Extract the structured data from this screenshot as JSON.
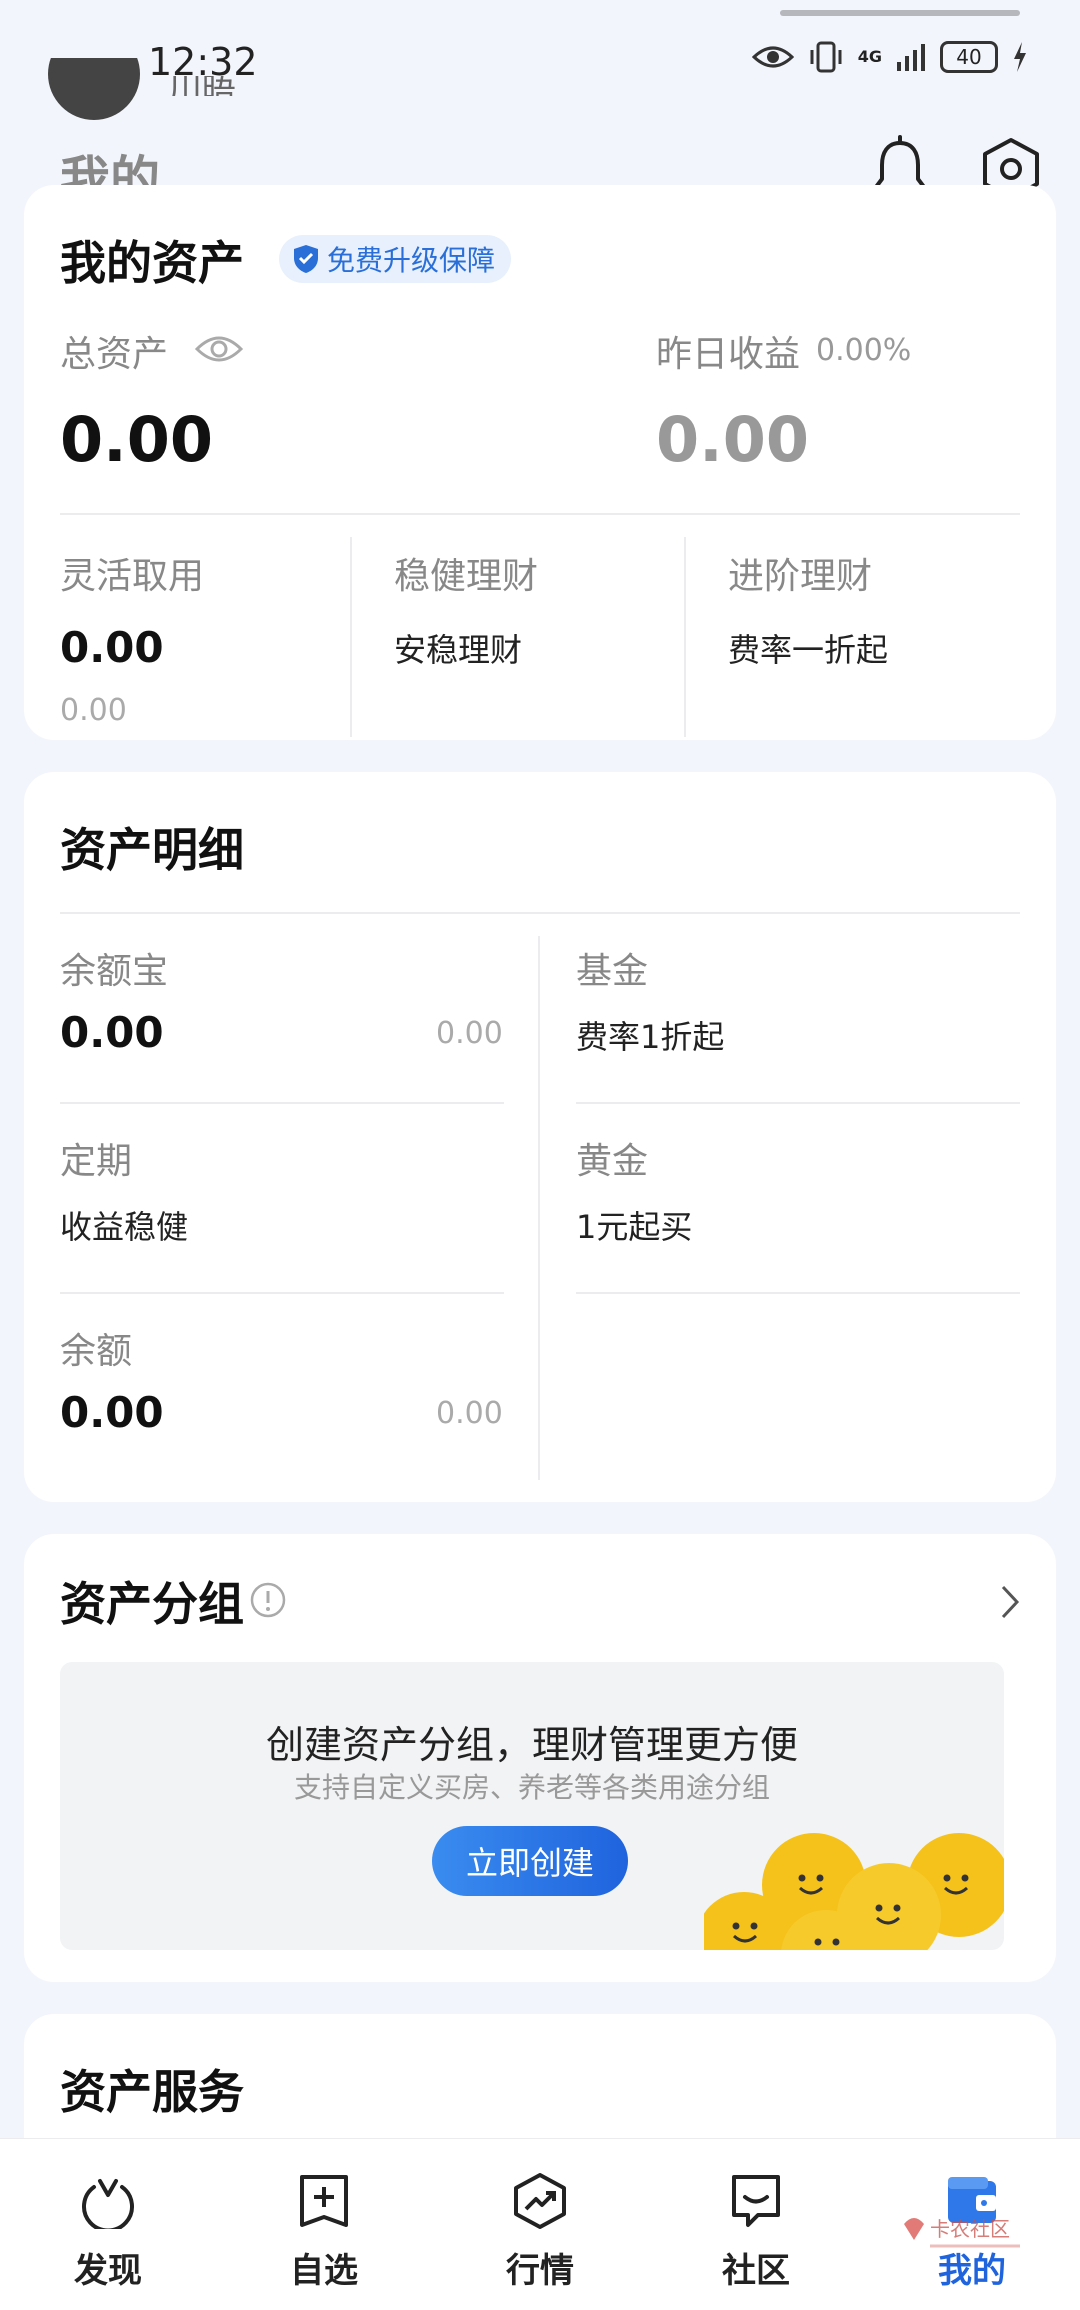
{
  "status_bar": {
    "time": "12:32",
    "network": "4G",
    "battery": "40"
  },
  "header": {
    "user_name_fragment": "川晤",
    "title": "我的"
  },
  "assets": {
    "title": "我的资产",
    "badge": "免费升级保障",
    "total_label": "总资产",
    "total_value": "0.00",
    "yesterday_label": "昨日收益",
    "yesterday_rate": "0.00%",
    "yesterday_value": "0.00",
    "columns": [
      {
        "label": "灵活取用",
        "value": "0.00",
        "sub": "0.00"
      },
      {
        "label": "稳健理财",
        "desc": "安稳理财"
      },
      {
        "label": "进阶理财",
        "desc": "费率一折起"
      }
    ]
  },
  "detail": {
    "title": "资产明细",
    "left": [
      {
        "label": "余额宝",
        "value": "0.00",
        "side": "0.00"
      },
      {
        "label": "定期",
        "desc": "收益稳健"
      },
      {
        "label": "余额",
        "value": "0.00",
        "side": "0.00"
      }
    ],
    "right": [
      {
        "label": "基金",
        "desc": "费率1折起"
      },
      {
        "label": "黄金",
        "desc": "1元起买"
      }
    ]
  },
  "grouping": {
    "title": "资产分组",
    "promo_title": "创建资产分组，理财管理更方便",
    "promo_sub": "支持自定义买房、养老等各类用途分组",
    "button": "立即创建"
  },
  "services": {
    "title": "资产服务"
  },
  "tabbar": [
    {
      "label": "发现",
      "icon": "discover-icon"
    },
    {
      "label": "自选",
      "icon": "watchlist-add-icon"
    },
    {
      "label": "行情",
      "icon": "market-trend-icon"
    },
    {
      "label": "社区",
      "icon": "community-chat-icon"
    },
    {
      "label": "我的",
      "icon": "wallet-icon",
      "active": true
    }
  ],
  "watermark": "卡农社区",
  "colors": {
    "accent": "#1f63dd",
    "background": "#f3f5fc",
    "badge_bg": "#e7f0fc",
    "coin": "#f5c21b"
  }
}
